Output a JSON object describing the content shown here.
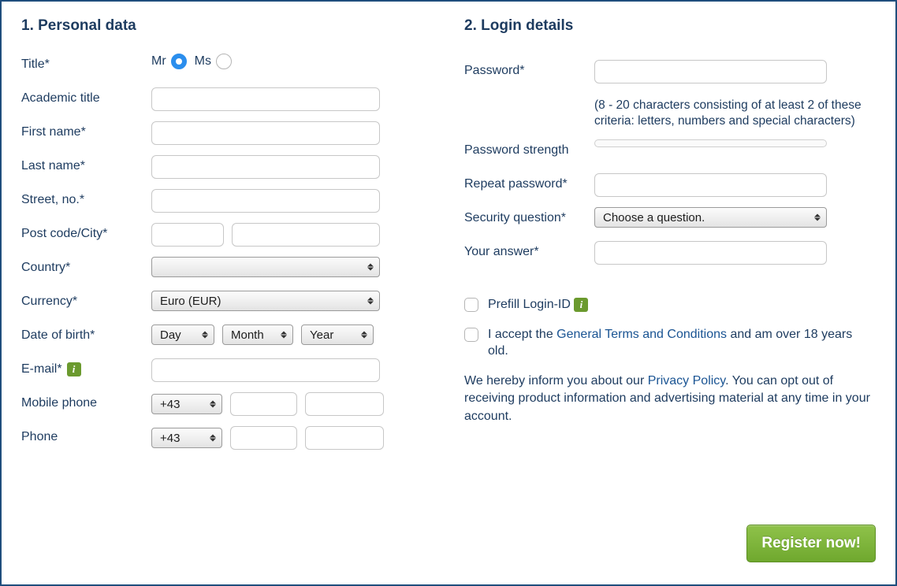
{
  "section1": {
    "heading": "1. Personal data",
    "labels": {
      "title": "Title*",
      "academic": "Academic title",
      "firstname": "First name*",
      "lastname": "Last name*",
      "street": "Street, no.*",
      "postcity": "Post code/City*",
      "country": "Country*",
      "currency": "Currency*",
      "dob": "Date of birth*",
      "email": "E-mail*",
      "mobile": "Mobile phone",
      "phone": "Phone"
    },
    "title_mr": "Mr",
    "title_ms": "Ms",
    "currency_value": "Euro (EUR)",
    "dob_day": "Day",
    "dob_month": "Month",
    "dob_year": "Year",
    "mobile_cc": "+43",
    "phone_cc": "+43"
  },
  "section2": {
    "heading": "2. Login details",
    "labels": {
      "password": "Password*",
      "strength": "Password strength",
      "repeat": "Repeat password*",
      "security": "Security question*",
      "answer": "Your answer*"
    },
    "password_hint": "(8 - 20 characters consisting of at least 2 of these criteria: letters, numbers and special characters)",
    "security_value": "Choose a question.",
    "prefill_label": "Prefill Login-ID",
    "terms_prefix": "I accept the ",
    "terms_link": "General Terms and Conditions",
    "terms_suffix": " and am over 18 years old.",
    "privacy_prefix": "We hereby inform you about our ",
    "privacy_link": "Privacy Policy",
    "privacy_suffix": ". You can opt out of receiving product information and advertising material at any time in your account.",
    "register_button": "Register now!"
  }
}
